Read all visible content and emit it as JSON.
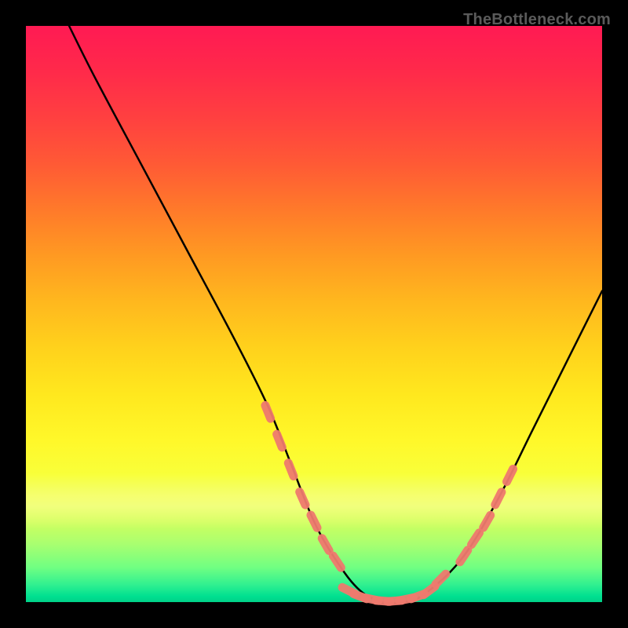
{
  "watermark": "TheBottleneck.com",
  "chart_data": {
    "type": "line",
    "title": "",
    "xlabel": "",
    "ylabel": "",
    "xlim": [
      0,
      100
    ],
    "ylim": [
      0,
      100
    ],
    "grid": false,
    "legend": false,
    "series": [
      {
        "name": "main-curve",
        "color": "#000000",
        "x": [
          7.5,
          12,
          20,
          28,
          36,
          42,
          46,
          50,
          54,
          58,
          62,
          66,
          70,
          76,
          82,
          88,
          94,
          100
        ],
        "y": [
          100,
          91,
          76,
          61,
          46,
          34,
          24,
          14,
          7,
          2,
          0,
          0,
          2,
          8,
          18,
          30,
          42,
          54
        ]
      },
      {
        "name": "highlight-left",
        "color": "#ef7a6e",
        "x": [
          42,
          44,
          46,
          48,
          50,
          52,
          54
        ],
        "y": [
          33,
          28,
          23,
          18,
          14,
          10,
          7
        ]
      },
      {
        "name": "highlight-bottom",
        "color": "#ef7a6e",
        "x": [
          56,
          58,
          60,
          62,
          64,
          66,
          68,
          70,
          72
        ],
        "y": [
          2,
          1,
          0.5,
          0.2,
          0.2,
          0.5,
          1,
          2,
          4
        ]
      },
      {
        "name": "highlight-right",
        "color": "#ef7a6e",
        "x": [
          76,
          78,
          80,
          82,
          84
        ],
        "y": [
          8,
          11,
          14,
          18,
          22
        ]
      }
    ]
  }
}
